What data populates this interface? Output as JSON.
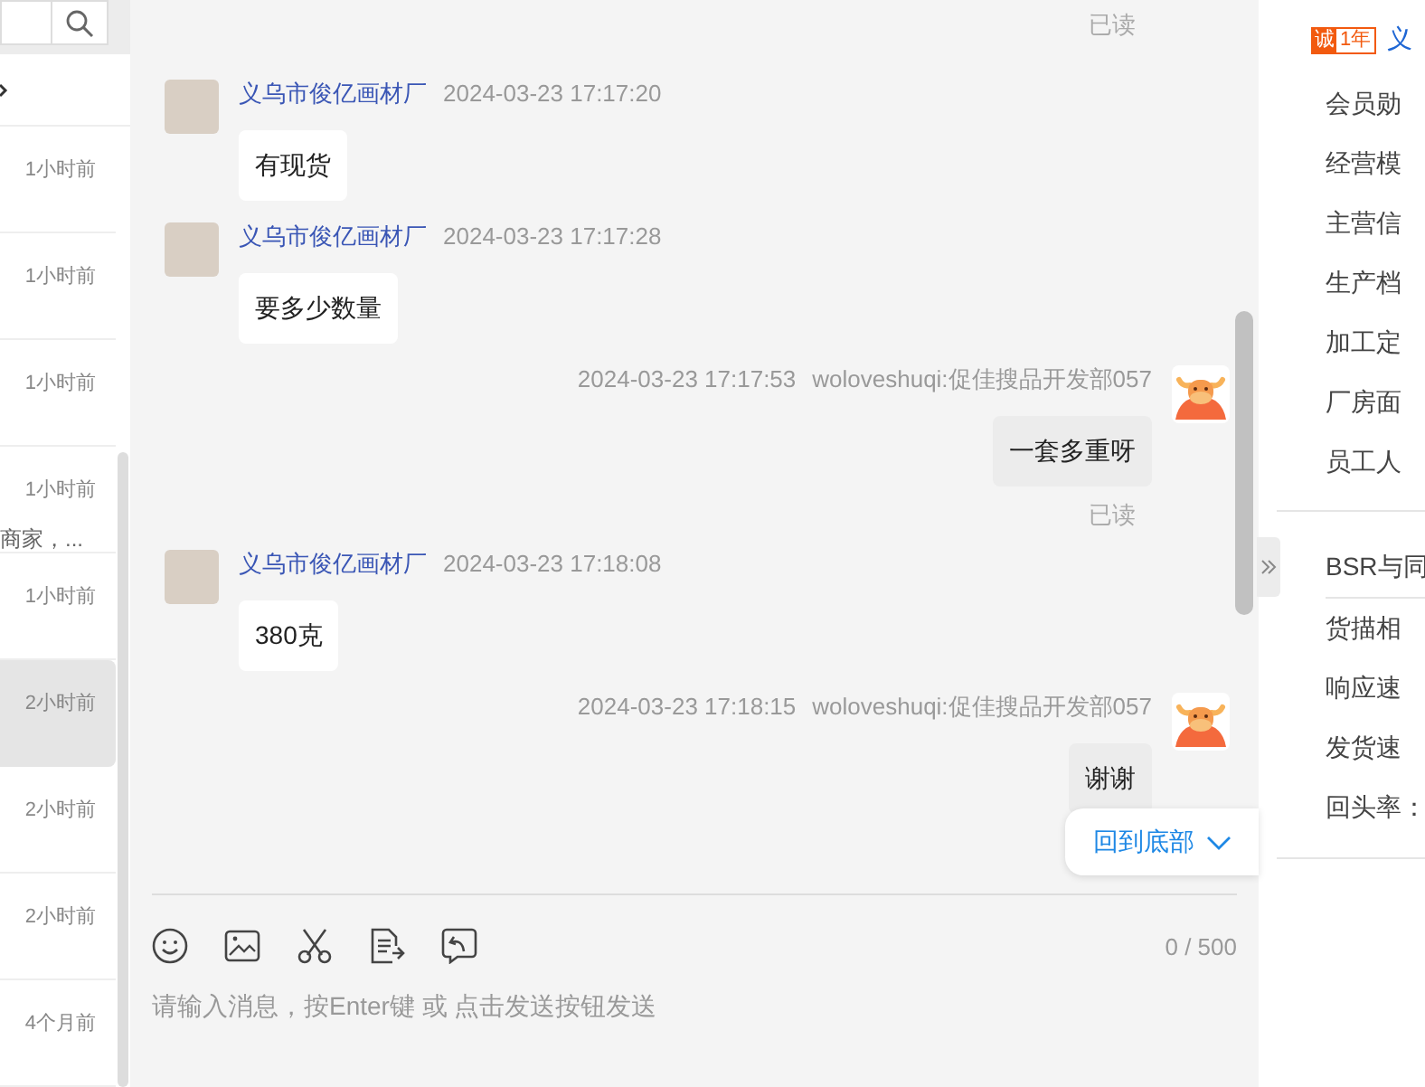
{
  "conversation_list": {
    "items": [
      {
        "time": "1小时前",
        "selected": false
      },
      {
        "time": "1小时前",
        "selected": false
      },
      {
        "time": "1小时前",
        "selected": false
      },
      {
        "time": "1小时前",
        "preview": "商家，...",
        "selected": false
      },
      {
        "time": "1小时前",
        "selected": false
      },
      {
        "time": "2小时前",
        "selected": true
      },
      {
        "time": "2小时前",
        "selected": false
      },
      {
        "time": "2小时前",
        "selected": false
      },
      {
        "time": "4个月前",
        "selected": false
      }
    ]
  },
  "chat": {
    "messages": [
      {
        "kind": "receipt",
        "text": "已读"
      },
      {
        "kind": "incoming",
        "sender": "义乌市俊亿画材厂",
        "time": "2024-03-23 17:17:20",
        "text": "有现货"
      },
      {
        "kind": "incoming",
        "sender": "义乌市俊亿画材厂",
        "time": "2024-03-23 17:17:28",
        "text": "要多少数量"
      },
      {
        "kind": "outgoing",
        "sender": "woloveshuqi:促佳搜品开发部057",
        "time": "2024-03-23 17:17:53",
        "text": "一套多重呀",
        "receipt": "已读"
      },
      {
        "kind": "incoming",
        "sender": "义乌市俊亿画材厂",
        "time": "2024-03-23 17:18:08",
        "text": "380克"
      },
      {
        "kind": "outgoing",
        "sender": "woloveshuqi:促佳搜品开发部057",
        "time": "2024-03-23 17:18:15",
        "text": "谢谢"
      }
    ],
    "back_to_bottom": "回到底部",
    "char_count": "0 / 500",
    "input": {
      "placeholder": "请输入消息，按Enter键 或 点击发送按钮发送"
    }
  },
  "shop_panel": {
    "badge": "诚",
    "badge_years": "1年",
    "shop_name": "义",
    "info": [
      "会员勋",
      "经营模",
      "主营信",
      "生产档",
      "加工定",
      "厂房面",
      "员工人"
    ],
    "ratings": [
      "BSR与同",
      "货描相",
      "响应速",
      "发货速",
      "回头率："
    ]
  }
}
